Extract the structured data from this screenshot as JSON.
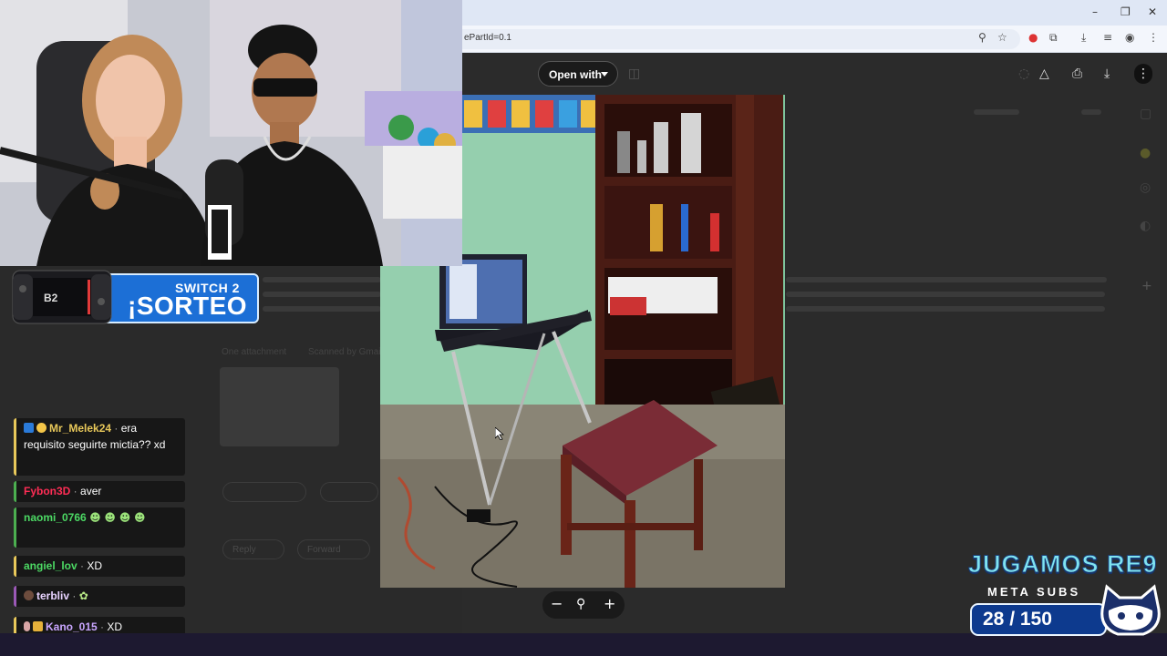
{
  "browser": {
    "url_fragment": "ePartId=0.1",
    "window_buttons": [
      "–",
      "❐",
      "✕"
    ]
  },
  "viewer": {
    "open_with_label": "Open with"
  },
  "sorteo_banner": {
    "subtitle": "SWITCH 2",
    "title": "¡SORTEO",
    "console_label": "B2"
  },
  "chat": {
    "messages": [
      {
        "user": "Mr_Melek24",
        "text": "era requisito seguirte mictia?? xd",
        "user_color": "#e8c85a",
        "bar_color": "#e8c85a"
      },
      {
        "user": "Fybon3D",
        "text": "aver",
        "user_color": "#ff2d55",
        "bar_color": "#4caf50"
      },
      {
        "user": "naomi_0766",
        "text": "",
        "user_color": "#4cd964",
        "bar_color": "#4caf50"
      },
      {
        "user": "angiel_lov",
        "text": "XD",
        "user_color": "#4cd964",
        "bar_color": "#e8c85a"
      },
      {
        "user": "terbliv",
        "text": "",
        "user_color": "#e8d3ff",
        "bar_color": "#9b59b6"
      },
      {
        "user": "Kano_015",
        "text": "XD",
        "user_color": "#c9a6ff",
        "bar_color": "#e8c85a"
      }
    ]
  },
  "overlay": {
    "headline": "JUGAMOS RE9",
    "label": "META SUBS",
    "subs_current": 28,
    "subs_goal": 150,
    "subs_text": "28 / 150"
  },
  "ghost": {
    "attachment_label": "One attachment",
    "scanned_label": "Scanned by Gmail",
    "reply_label": "Reply",
    "forward_label": "Forward"
  }
}
